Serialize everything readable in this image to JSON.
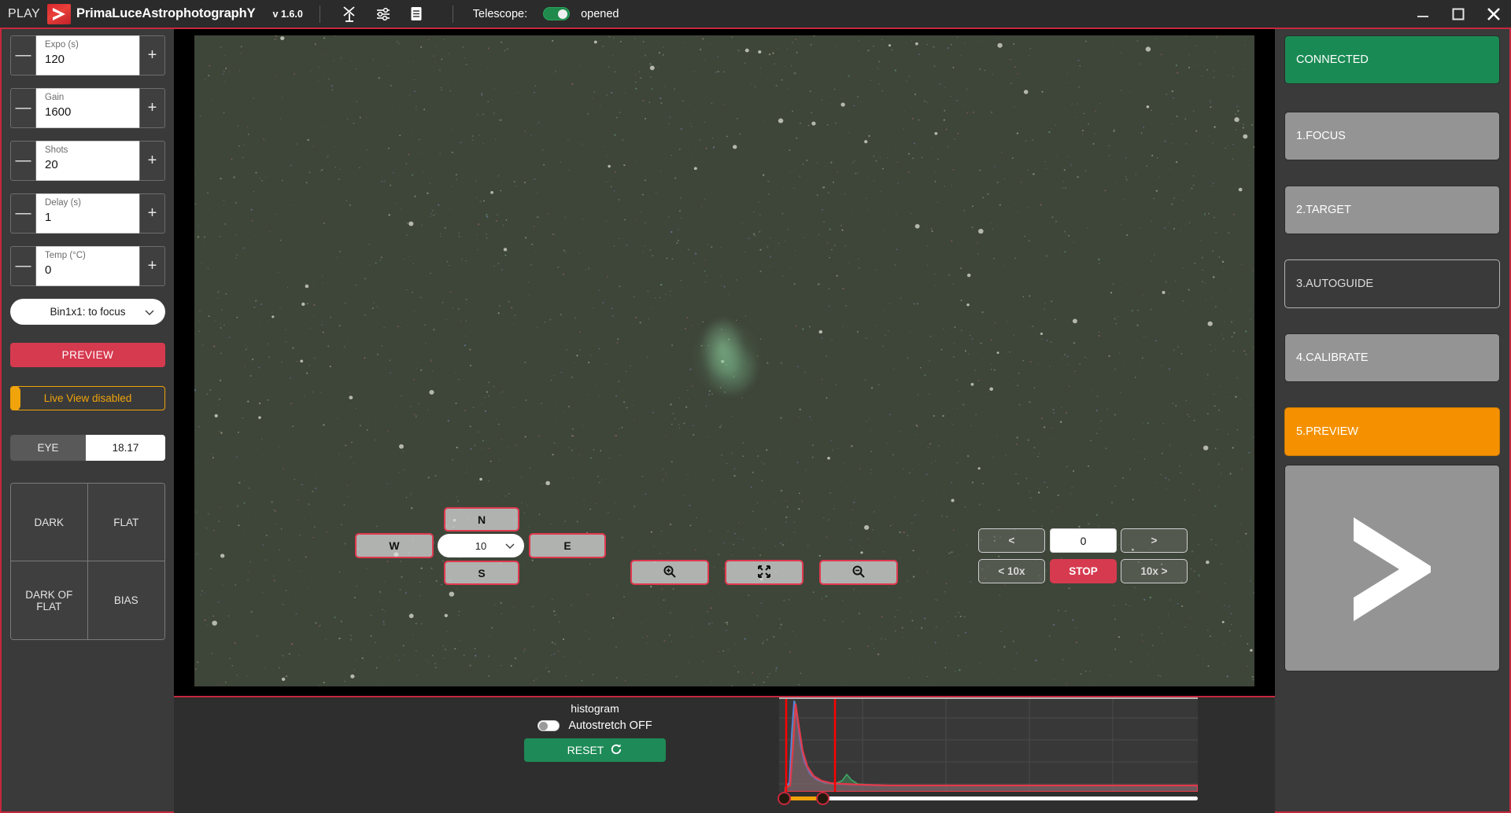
{
  "titlebar": {
    "play_label": "PLAY",
    "brand": "PrimaLuceAstrophotographY",
    "version": "v 1.6.0",
    "telescope_label": "Telescope:",
    "telescope_state": "opened",
    "icons": {
      "telescope": "telescope-icon",
      "sliders": "sliders-icon",
      "book": "book-icon",
      "logo": "primalucelab-logo",
      "minimize": "minimize-icon",
      "maximize": "maximize-icon",
      "close": "close-icon"
    }
  },
  "left_panel": {
    "steppers": [
      {
        "label": "Expo (s)",
        "value": "120",
        "minus": "—",
        "plus": "+"
      },
      {
        "label": "Gain",
        "value": "1600",
        "minus": "—",
        "plus": "+"
      },
      {
        "label": "Shots",
        "value": "20",
        "minus": "—",
        "plus": "+"
      },
      {
        "label": "Delay (s)",
        "value": "1",
        "minus": "—",
        "plus": "+"
      },
      {
        "label": "Temp (°C)",
        "value": "0",
        "minus": "—",
        "plus": "+"
      }
    ],
    "bin_select": "Bin1x1: to focus",
    "preview_button": "PREVIEW",
    "live_view": "Live View disabled",
    "eye_label": "EYE",
    "eye_value": "18.17",
    "calibration": [
      "DARK",
      "FLAT",
      "DARK OF FLAT",
      "BIAS"
    ]
  },
  "viewport": {
    "dpad": {
      "north": "N",
      "south": "S",
      "west": "W",
      "east": "E",
      "step_select": "10"
    },
    "zoom": {
      "zoom_in": "zoom-in-icon",
      "fit": "fit-screen-icon",
      "zoom_out": "zoom-out-icon"
    },
    "focuser": {
      "left": "<",
      "right": ">",
      "position": "0",
      "left_10x": "< 10x",
      "right_10x": "10x >",
      "stop": "STOP"
    }
  },
  "histogram": {
    "title": "histogram",
    "autostretch": "Autostretch OFF",
    "reset_button": "RESET",
    "reset_icon": "refresh-icon",
    "slider": {
      "low": 6,
      "high": 56
    }
  },
  "right_panel": {
    "status": "CONNECTED",
    "steps": [
      "1.FOCUS",
      "2.TARGET",
      "3.AUTOGUIDE",
      "4.CALIBRATE",
      "5.PREVIEW"
    ],
    "logo": "primalucelab-chevron-logo"
  },
  "colors": {
    "accent_red": "#c5283d",
    "preview_red": "#d63a4f",
    "connected_green": "#1a8a54",
    "reset_green": "#1e8a57",
    "orange": "#f59100",
    "live_view_orange": "#f0a30a",
    "panel_bg": "#3a3a3a",
    "app_bg": "#2e2e2e"
  }
}
